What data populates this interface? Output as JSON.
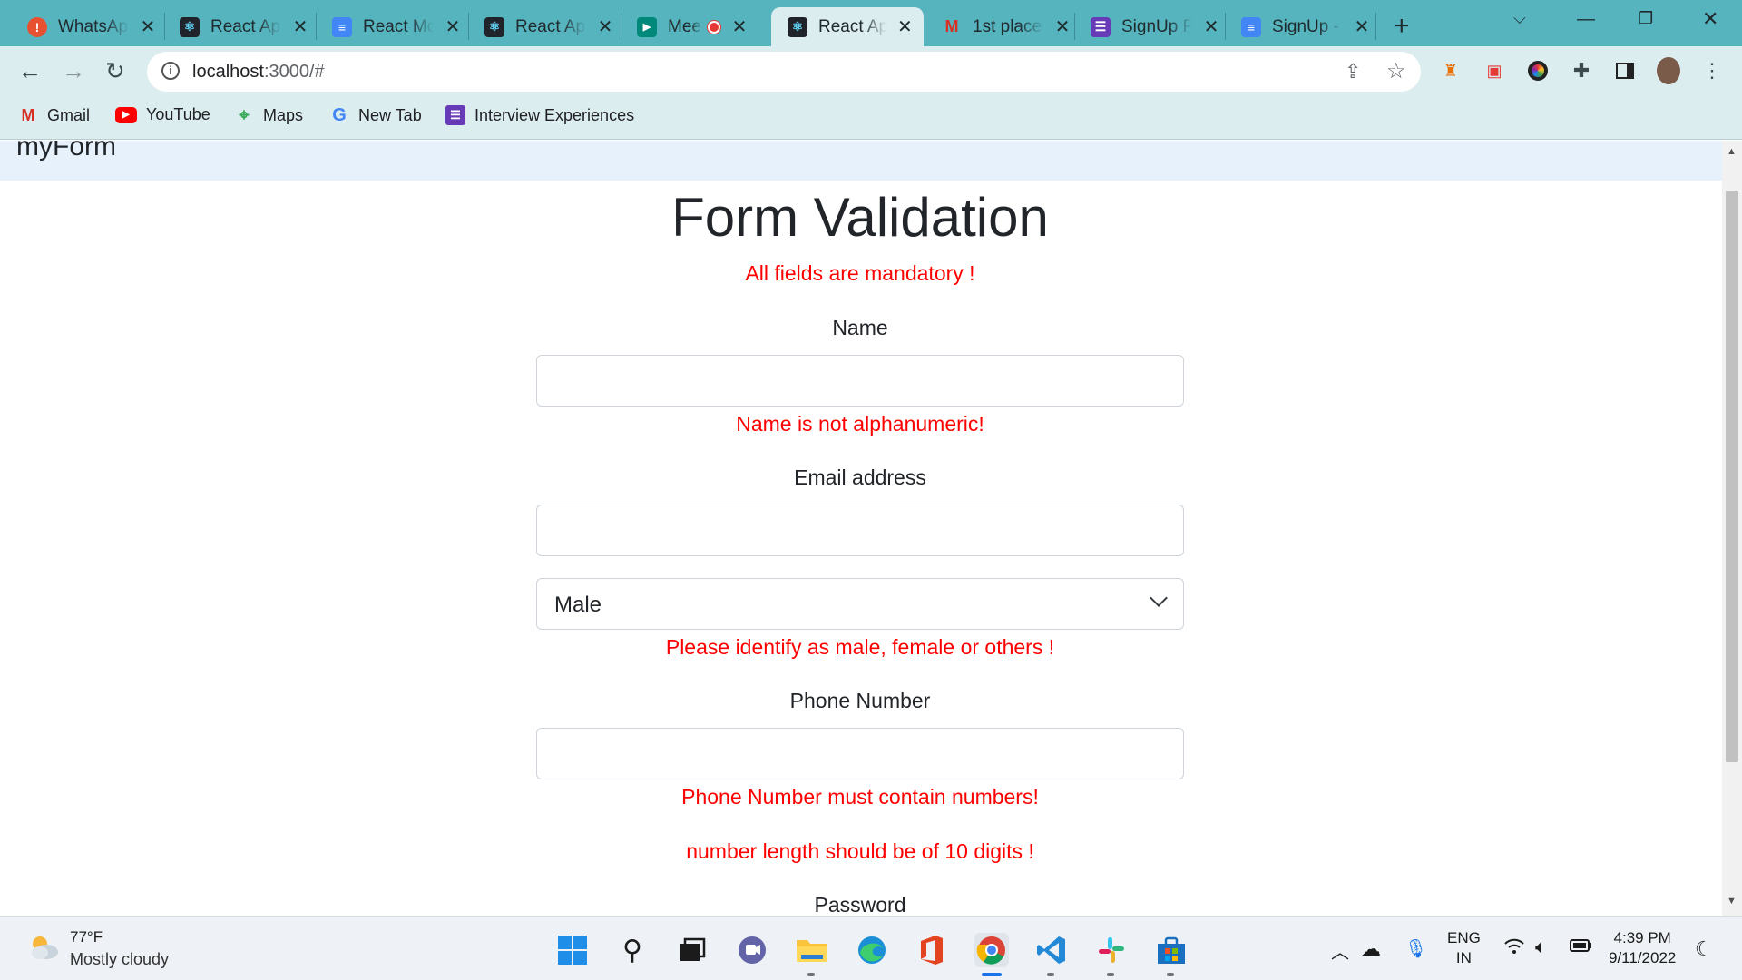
{
  "browser": {
    "tabs": [
      {
        "title": "WhatsApp",
        "icon": "whatsapp-alert-icon",
        "color": "#e8512f",
        "glyph": "!"
      },
      {
        "title": "React App",
        "icon": "react-icon",
        "color": "#20232a",
        "glyph": "⚛"
      },
      {
        "title": "React Mode",
        "icon": "google-docs-icon",
        "color": "#4285f4",
        "glyph": "≡"
      },
      {
        "title": "React App",
        "icon": "react-icon",
        "color": "#20232a",
        "glyph": "⚛"
      },
      {
        "title": "Meet",
        "icon": "google-meet-icon",
        "color": "#00897b",
        "glyph": "▶"
      },
      {
        "title": "React App",
        "icon": "react-icon",
        "color": "#20232a",
        "glyph": "⚛"
      },
      {
        "title": "1st place",
        "icon": "gmail-icon",
        "color": "#ffffff",
        "glyph": "M"
      },
      {
        "title": "SignUp Form",
        "icon": "google-forms-icon",
        "color": "#673ab7",
        "glyph": "☰"
      },
      {
        "title": "SignUp - Google",
        "icon": "google-docs-icon",
        "color": "#4285f4",
        "glyph": "≡"
      }
    ],
    "address": {
      "host": "localhost",
      "path": ":3000/#"
    },
    "bookmarks": [
      {
        "label": "Gmail",
        "icon": "gmail-icon"
      },
      {
        "label": "YouTube",
        "icon": "youtube-icon"
      },
      {
        "label": "Maps",
        "icon": "maps-icon"
      },
      {
        "label": "New Tab",
        "icon": "google-icon"
      },
      {
        "label": "Interview Experiences",
        "icon": "google-forms-icon"
      }
    ]
  },
  "page": {
    "brand": "myForm",
    "title": "Form Validation",
    "mandatory_note": "All fields are mandatory !",
    "name_label": "Name",
    "name_error": "Name is not alphanumeric!",
    "email_label": "Email address",
    "gender_value": "Male",
    "gender_error": "Please identify as male, female or others !",
    "phone_label": "Phone Number",
    "phone_error_1": "Phone Number must contain numbers!",
    "phone_error_2": "number length should be of 10 digits !",
    "password_label": "Password",
    "error_color": "#ff0000"
  },
  "taskbar": {
    "weather_temp": "77°F",
    "weather_desc": "Mostly cloudy",
    "lang_1": "ENG",
    "lang_2": "IN",
    "time": "4:39 PM",
    "date": "9/11/2022"
  }
}
